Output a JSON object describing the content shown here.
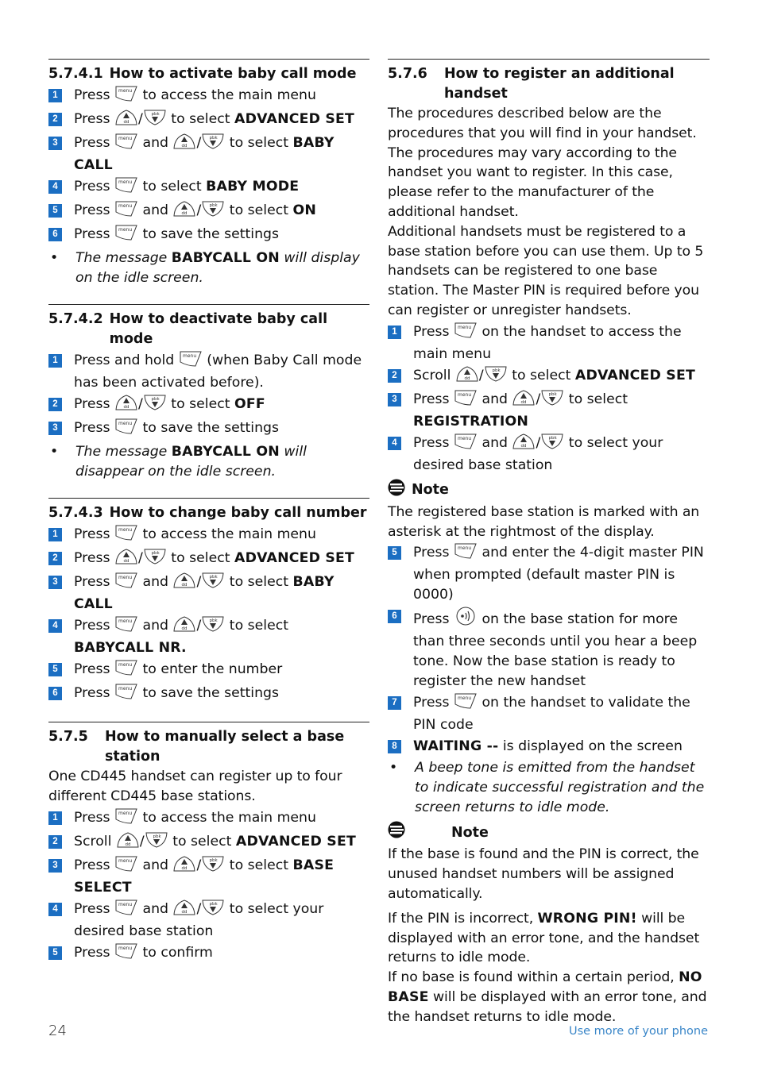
{
  "colors": {
    "badge": "#1b6ec2",
    "footer_link": "#3a86c8"
  },
  "left_column": [
    {
      "number": "5.7.4.1",
      "title": "How to activate baby call mode",
      "style": "narrow",
      "blocks": [
        {
          "type": "step",
          "n": "1",
          "segs": [
            [
              "t",
              "Press "
            ],
            [
              "icon",
              "menu-key-icon"
            ],
            [
              "t",
              " to access the main menu"
            ]
          ]
        },
        {
          "type": "step",
          "n": "2",
          "segs": [
            [
              "t",
              "Press "
            ],
            [
              "icon",
              "up-key-icon"
            ],
            [
              "t",
              "/"
            ],
            [
              "icon",
              "down-key-icon"
            ],
            [
              "t",
              " to select "
            ],
            [
              "b",
              "ADVANCED SET"
            ]
          ]
        },
        {
          "type": "step",
          "n": "3",
          "segs": [
            [
              "t",
              "Press "
            ],
            [
              "icon",
              "menu-key-icon"
            ],
            [
              "t",
              " and "
            ],
            [
              "icon",
              "up-key-icon"
            ],
            [
              "t",
              "/"
            ],
            [
              "icon",
              "down-key-icon"
            ],
            [
              "t",
              " to select "
            ],
            [
              "b",
              "BABY CALL"
            ]
          ]
        },
        {
          "type": "step",
          "n": "4",
          "segs": [
            [
              "t",
              "Press "
            ],
            [
              "icon",
              "menu-key-icon"
            ],
            [
              "t",
              " to select "
            ],
            [
              "b",
              "BABY MODE"
            ]
          ]
        },
        {
          "type": "step",
          "n": "5",
          "segs": [
            [
              "t",
              "Press "
            ],
            [
              "icon",
              "menu-key-icon"
            ],
            [
              "t",
              " and "
            ],
            [
              "icon",
              "up-key-icon"
            ],
            [
              "t",
              "/"
            ],
            [
              "icon",
              "down-key-icon"
            ],
            [
              "t",
              " to select "
            ],
            [
              "b",
              "ON"
            ]
          ]
        },
        {
          "type": "step",
          "n": "6",
          "segs": [
            [
              "t",
              "Press "
            ],
            [
              "icon",
              "menu-key-icon"
            ],
            [
              "t",
              " to save the settings"
            ]
          ]
        },
        {
          "type": "bullet",
          "segs": [
            [
              "i",
              "The message "
            ],
            [
              "b",
              "BABYCALL ON"
            ],
            [
              "i",
              " will display on the idle screen."
            ]
          ]
        }
      ]
    },
    {
      "number": "5.7.4.2",
      "title": "How to deactivate baby call mode",
      "style": "narrow",
      "blocks": [
        {
          "type": "step",
          "n": "1",
          "segs": [
            [
              "t",
              "Press and hold "
            ],
            [
              "icon",
              "menu-key-icon"
            ],
            [
              "t",
              " (when Baby Call mode has been activated before)."
            ]
          ]
        },
        {
          "type": "step",
          "n": "2",
          "segs": [
            [
              "t",
              "Press "
            ],
            [
              "icon",
              "up-key-icon"
            ],
            [
              "t",
              "/"
            ],
            [
              "icon",
              "down-key-icon"
            ],
            [
              "t",
              " to select "
            ],
            [
              "b",
              "OFF"
            ]
          ]
        },
        {
          "type": "step",
          "n": "3",
          "segs": [
            [
              "t",
              "Press "
            ],
            [
              "icon",
              "menu-key-icon"
            ],
            [
              "t",
              " to save the settings"
            ]
          ]
        },
        {
          "type": "bullet",
          "segs": [
            [
              "i",
              "The message "
            ],
            [
              "b",
              "BABYCALL ON"
            ],
            [
              "i",
              " will disappear on the idle screen."
            ]
          ]
        }
      ]
    },
    {
      "number": "5.7.4.3",
      "title": "How to change baby call number",
      "style": "narrow",
      "blocks": [
        {
          "type": "step",
          "n": "1",
          "segs": [
            [
              "t",
              "Press "
            ],
            [
              "icon",
              "menu-key-icon"
            ],
            [
              "t",
              " to access the main menu"
            ]
          ]
        },
        {
          "type": "step",
          "n": "2",
          "segs": [
            [
              "t",
              "Press "
            ],
            [
              "icon",
              "up-key-icon"
            ],
            [
              "t",
              "/"
            ],
            [
              "icon",
              "down-key-icon"
            ],
            [
              "t",
              " to select "
            ],
            [
              "b",
              "ADVANCED SET"
            ]
          ]
        },
        {
          "type": "step",
          "n": "3",
          "segs": [
            [
              "t",
              "Press "
            ],
            [
              "icon",
              "menu-key-icon"
            ],
            [
              "t",
              " and "
            ],
            [
              "icon",
              "up-key-icon"
            ],
            [
              "t",
              "/"
            ],
            [
              "icon",
              "down-key-icon"
            ],
            [
              "t",
              " to select "
            ],
            [
              "b",
              "BABY CALL"
            ]
          ]
        },
        {
          "type": "step",
          "n": "4",
          "segs": [
            [
              "t",
              "Press "
            ],
            [
              "icon",
              "menu-key-icon"
            ],
            [
              "t",
              " and "
            ],
            [
              "icon",
              "up-key-icon"
            ],
            [
              "t",
              "/"
            ],
            [
              "icon",
              "down-key-icon"
            ],
            [
              "t",
              " to select "
            ],
            [
              "b",
              "BABYCALL NR."
            ]
          ]
        },
        {
          "type": "step",
          "n": "5",
          "segs": [
            [
              "t",
              "Press "
            ],
            [
              "icon",
              "menu-key-icon"
            ],
            [
              "t",
              " to enter the number"
            ]
          ]
        },
        {
          "type": "step",
          "n": "6",
          "segs": [
            [
              "t",
              "Press "
            ],
            [
              "icon",
              "menu-key-icon"
            ],
            [
              "t",
              " to save the settings"
            ]
          ]
        }
      ]
    },
    {
      "number": "5.7.5",
      "title": "How to manually select a base station",
      "style": "wide",
      "blocks": [
        {
          "type": "para",
          "segs": [
            [
              "t",
              "One CD445 handset can register up to four different CD445 base stations."
            ]
          ]
        },
        {
          "type": "step",
          "n": "1",
          "segs": [
            [
              "t",
              "Press "
            ],
            [
              "icon",
              "menu-key-icon"
            ],
            [
              "t",
              " to access the main menu"
            ]
          ]
        },
        {
          "type": "step",
          "n": "2",
          "segs": [
            [
              "t",
              "Scroll "
            ],
            [
              "icon",
              "up-key-icon"
            ],
            [
              "t",
              "/"
            ],
            [
              "icon",
              "down-key-icon"
            ],
            [
              "t",
              " to select "
            ],
            [
              "b",
              "ADVANCED SET"
            ]
          ]
        },
        {
          "type": "step",
          "n": "3",
          "segs": [
            [
              "t",
              "Press "
            ],
            [
              "icon",
              "menu-key-icon"
            ],
            [
              "t",
              " and "
            ],
            [
              "icon",
              "up-key-icon"
            ],
            [
              "t",
              "/"
            ],
            [
              "icon",
              "down-key-icon"
            ],
            [
              "t",
              " to select "
            ],
            [
              "b",
              "BASE SELECT"
            ]
          ]
        },
        {
          "type": "step",
          "n": "4",
          "segs": [
            [
              "t",
              "Press "
            ],
            [
              "icon",
              "menu-key-icon"
            ],
            [
              "t",
              " and "
            ],
            [
              "icon",
              "up-key-icon"
            ],
            [
              "t",
              "/"
            ],
            [
              "icon",
              "down-key-icon"
            ],
            [
              "t",
              " to select your desired base station"
            ]
          ]
        },
        {
          "type": "step",
          "n": "5",
          "segs": [
            [
              "t",
              "Press "
            ],
            [
              "icon",
              "menu-key-icon"
            ],
            [
              "t",
              " to confirm"
            ]
          ]
        }
      ]
    }
  ],
  "right_column": [
    {
      "number": "5.7.6",
      "title": "How to register an additional handset",
      "style": "wide",
      "blocks": [
        {
          "type": "para",
          "segs": [
            [
              "t",
              "The procedures described below are the procedures that you will find in your handset. The procedures may vary according to the handset you want to register. In this case, please refer to the manufacturer of the additional handset."
            ]
          ]
        },
        {
          "type": "para",
          "segs": [
            [
              "t",
              "Additional handsets must be registered to a base station before you can use them. Up to 5 handsets can be registered to one base station. The Master PIN is required before you can register or unregister handsets."
            ]
          ]
        },
        {
          "type": "step",
          "n": "1",
          "segs": [
            [
              "t",
              "Press "
            ],
            [
              "icon",
              "menu-key-icon"
            ],
            [
              "t",
              " on the handset to access the main menu"
            ]
          ]
        },
        {
          "type": "step",
          "n": "2",
          "segs": [
            [
              "t",
              "Scroll "
            ],
            [
              "icon",
              "up-key-icon"
            ],
            [
              "t",
              "/"
            ],
            [
              "icon",
              "down-key-icon"
            ],
            [
              "t",
              " to select "
            ],
            [
              "b",
              "ADVANCED SET"
            ]
          ]
        },
        {
          "type": "step",
          "n": "3",
          "segs": [
            [
              "t",
              "Press "
            ],
            [
              "icon",
              "menu-key-icon"
            ],
            [
              "t",
              " and "
            ],
            [
              "icon",
              "up-key-icon"
            ],
            [
              "t",
              "/"
            ],
            [
              "icon",
              "down-key-icon"
            ],
            [
              "t",
              " to select "
            ],
            [
              "b",
              "REGISTRATION"
            ]
          ]
        },
        {
          "type": "step",
          "n": "4",
          "segs": [
            [
              "t",
              "Press "
            ],
            [
              "icon",
              "menu-key-icon"
            ],
            [
              "t",
              " and "
            ],
            [
              "icon",
              "up-key-icon"
            ],
            [
              "t",
              "/"
            ],
            [
              "icon",
              "down-key-icon"
            ],
            [
              "t",
              " to select your desired base station"
            ]
          ]
        },
        {
          "type": "note",
          "label": "Note"
        },
        {
          "type": "para",
          "segs": [
            [
              "t",
              "The registered base station is marked with an asterisk at the rightmost of the display."
            ]
          ]
        },
        {
          "type": "step",
          "n": "5",
          "segs": [
            [
              "t",
              "Press "
            ],
            [
              "icon",
              "menu-key-icon"
            ],
            [
              "t",
              " and enter the 4-digit master PIN when prompted (default master PIN is 0000)"
            ]
          ]
        },
        {
          "type": "step",
          "n": "6",
          "segs": [
            [
              "t",
              "Press "
            ],
            [
              "icon",
              "paging-key-icon"
            ],
            [
              "t",
              " on the base station for more than three seconds until you hear a beep tone. Now the base station is ready to register the new handset"
            ]
          ]
        },
        {
          "type": "step",
          "n": "7",
          "segs": [
            [
              "t",
              "Press "
            ],
            [
              "icon",
              "menu-key-icon"
            ],
            [
              "t",
              " on the handset to validate the PIN code"
            ]
          ]
        },
        {
          "type": "step",
          "n": "8",
          "segs": [
            [
              "b",
              "WAITING --"
            ],
            [
              "t",
              " is displayed on the screen"
            ]
          ]
        },
        {
          "type": "bullet",
          "segs": [
            [
              "i",
              "A beep tone is emitted from the handset to indicate successful registration and the screen returns to idle mode."
            ]
          ]
        },
        {
          "type": "note",
          "label": "Note",
          "spaced": true
        },
        {
          "type": "para",
          "segs": [
            [
              "t",
              "If the base is found and the PIN is correct, the unused handset numbers will be assigned automatically."
            ]
          ]
        },
        {
          "type": "gap"
        },
        {
          "type": "para",
          "segs": [
            [
              "t",
              "If the PIN is incorrect, "
            ],
            [
              "b",
              "WRONG PIN!"
            ],
            [
              "t",
              " will be displayed with an error tone, and the handset returns to idle mode."
            ]
          ]
        },
        {
          "type": "para",
          "segs": [
            [
              "t",
              "If no base is found within a certain period, "
            ],
            [
              "b",
              "NO BASE"
            ],
            [
              "t",
              " will be displayed with an error tone, and the handset returns to idle mode."
            ]
          ]
        }
      ]
    }
  ],
  "footer": {
    "page_number": "24",
    "section_title": "Use more of your phone"
  }
}
